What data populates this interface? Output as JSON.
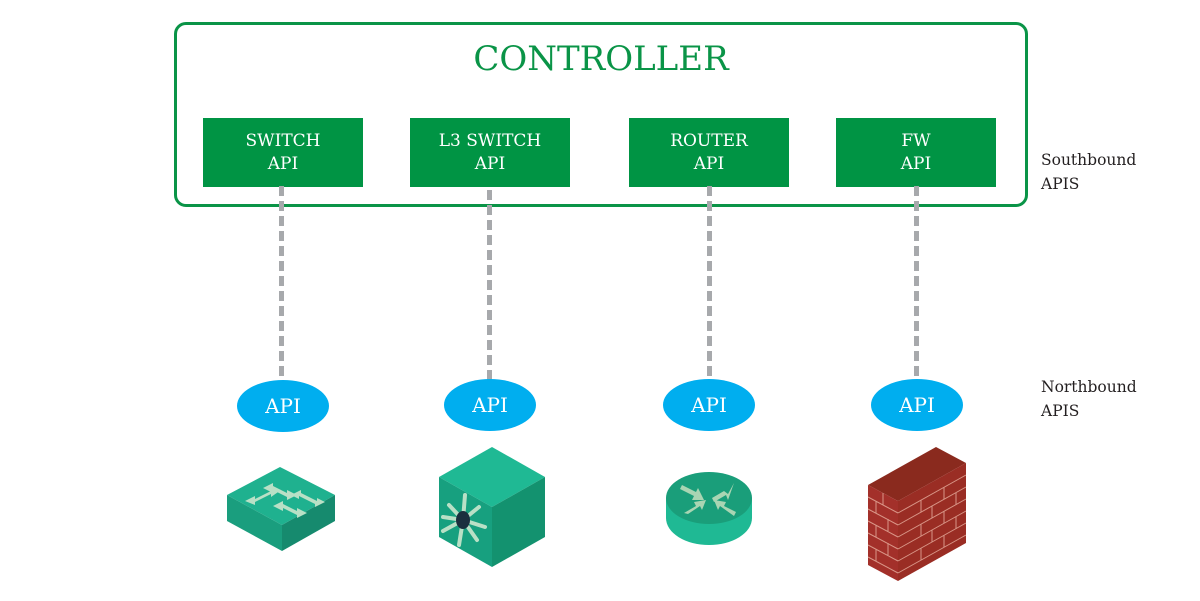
{
  "controller": {
    "title": "CONTROLLER",
    "apis": [
      {
        "line1": "SWITCH",
        "line2": "API"
      },
      {
        "line1": "L3 SWITCH",
        "line2": "API"
      },
      {
        "line1": "ROUTER",
        "line2": "API"
      },
      {
        "line1": "FW",
        "line2": "API"
      }
    ]
  },
  "labels": {
    "southbound": {
      "line1": "Southbound",
      "line2": "APIS"
    },
    "northbound": {
      "line1": "Northbound",
      "line2": "APIS"
    }
  },
  "devices": [
    {
      "api_label": "API",
      "type": "switch",
      "icon": "switch-icon"
    },
    {
      "api_label": "API",
      "type": "l3-switch",
      "icon": "l3-switch-icon"
    },
    {
      "api_label": "API",
      "type": "router",
      "icon": "router-icon"
    },
    {
      "api_label": "API",
      "type": "firewall",
      "icon": "firewall-icon"
    }
  ],
  "colors": {
    "controller_green": "#0a9447",
    "api_box_green": "#009444",
    "api_ellipse_blue": "#00aeef",
    "connector_gray": "#a7a9ac",
    "device_teal": "#1fb18f",
    "firewall_brick": "#a3302a"
  }
}
